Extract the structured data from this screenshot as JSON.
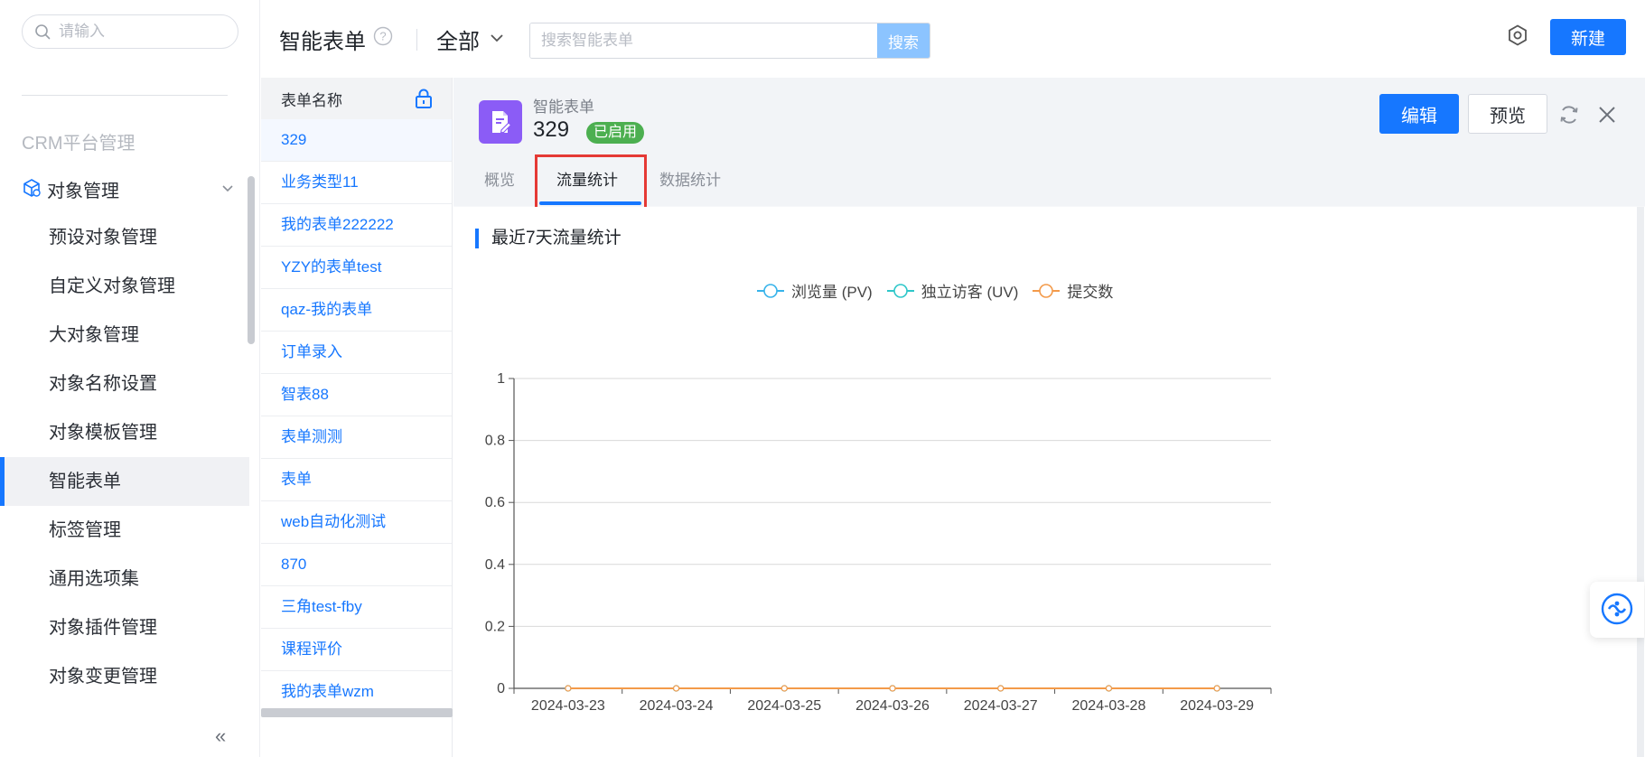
{
  "sidebar": {
    "search_placeholder": "请输入",
    "section_title": "CRM平台管理",
    "group": {
      "label": "对象管理",
      "icon": "object-cube-icon"
    },
    "items": [
      {
        "label": "预设对象管理",
        "active": false
      },
      {
        "label": "自定义对象管理",
        "active": false
      },
      {
        "label": "大对象管理",
        "active": false
      },
      {
        "label": "对象名称设置",
        "active": false
      },
      {
        "label": "对象模板管理",
        "active": false
      },
      {
        "label": "智能表单",
        "active": true
      },
      {
        "label": "标签管理",
        "active": false
      },
      {
        "label": "通用选项集",
        "active": false
      },
      {
        "label": "对象插件管理",
        "active": false
      },
      {
        "label": "对象变更管理",
        "active": false
      }
    ],
    "collapse_label": "«"
  },
  "header": {
    "title": "智能表单",
    "filter_value": "全部",
    "search_placeholder": "搜索智能表单",
    "search_button": "搜索",
    "new_button": "新建"
  },
  "form_list": {
    "header": "表单名称",
    "items": [
      "329",
      "业务类型11",
      "我的表单222222",
      "YZY的表单test",
      "qaz-我的表单",
      "订单录入",
      "智表88",
      "表单测测",
      "表单",
      "web自动化测试",
      "870",
      "三角test-fby",
      "课程评价",
      "我的表单wzm"
    ],
    "selected_index": 0
  },
  "detail": {
    "type_label": "智能表单",
    "name": "329",
    "status": "已启用",
    "edit_button": "编辑",
    "preview_button": "预览",
    "tabs": [
      "概览",
      "流量统计",
      "数据统计"
    ],
    "active_tab": 1,
    "section_title": "最近7天流量统计"
  },
  "colors": {
    "primary": "#1677ff",
    "status_green": "#4caf50",
    "form_icon_purple": "#8b5cf6",
    "highlight_red": "#e53935",
    "series_pv": "#36b3ea",
    "series_uv": "#2ec7c9",
    "series_submit": "#f39a4a"
  },
  "chart_data": {
    "type": "line",
    "title": "",
    "xlabel": "",
    "ylabel": "",
    "categories": [
      "2024-03-23",
      "2024-03-24",
      "2024-03-25",
      "2024-03-26",
      "2024-03-27",
      "2024-03-28",
      "2024-03-29"
    ],
    "series": [
      {
        "name": "浏览量 (PV)",
        "color": "#36b3ea",
        "values": [
          0,
          0,
          0,
          0,
          0,
          0,
          0
        ]
      },
      {
        "name": "独立访客 (UV)",
        "color": "#2ec7c9",
        "values": [
          0,
          0,
          0,
          0,
          0,
          0,
          0
        ]
      },
      {
        "name": "提交数",
        "color": "#f39a4a",
        "values": [
          0,
          0,
          0,
          0,
          0,
          0,
          0
        ]
      }
    ],
    "ylim": [
      0,
      1
    ],
    "yticks": [
      "0",
      "0.2",
      "0.4",
      "0.6",
      "0.8",
      "1"
    ],
    "grid": true,
    "legend_position": "top-center"
  }
}
